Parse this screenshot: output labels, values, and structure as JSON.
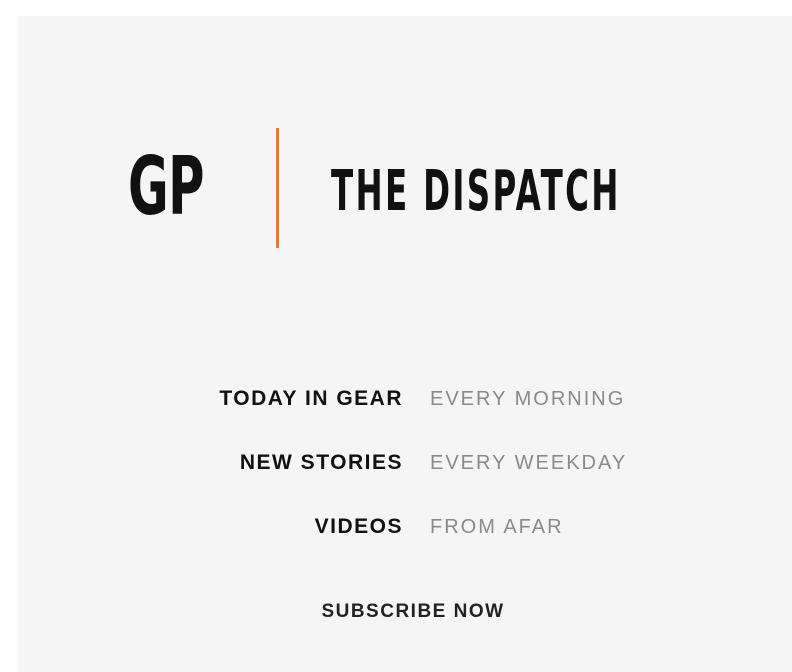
{
  "logo": {
    "initials": "GP",
    "divider_color": "#e07a3a"
  },
  "publication": {
    "title": "THE DISPATCH"
  },
  "features": [
    {
      "name": "TODAY IN GEAR",
      "frequency": "EVERY MORNING"
    },
    {
      "name": "NEW STORIES",
      "frequency": "EVERY WEEKDAY"
    },
    {
      "name": "VIDEOS",
      "frequency": "FROM AFAR"
    }
  ],
  "cta": {
    "label": "SUBSCRIBE NOW"
  }
}
